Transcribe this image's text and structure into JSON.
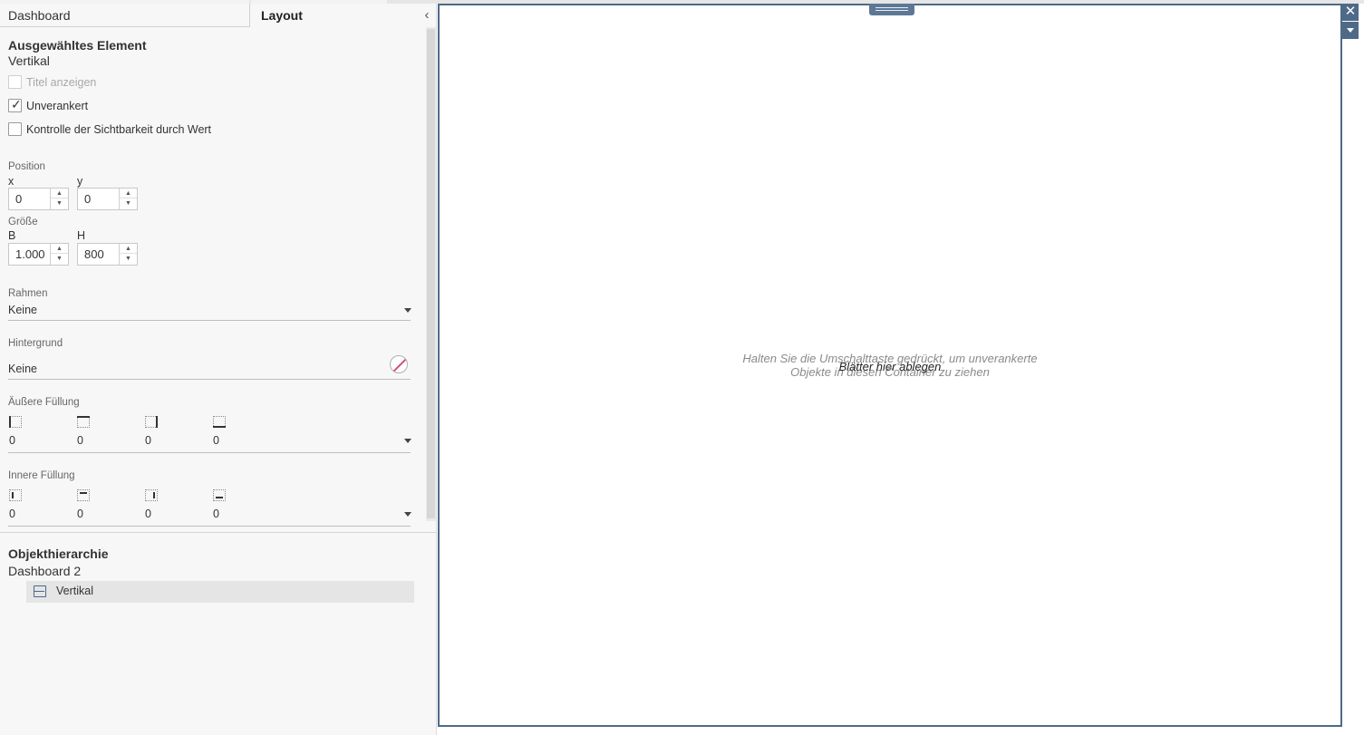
{
  "tabs": {
    "dashboard": "Dashboard",
    "layout": "Layout"
  },
  "collapse_glyph": "‹",
  "selected": {
    "heading": "Ausgewähltes Element",
    "type": "Vertikal"
  },
  "checkboxes": {
    "show_title": {
      "label": "Titel anzeigen",
      "checked": false,
      "disabled": true
    },
    "floating": {
      "label": "Unverankert",
      "checked": true,
      "disabled": false
    },
    "visibility": {
      "label": "Kontrolle der Sichtbarkeit durch Wert",
      "checked": false,
      "disabled": false
    }
  },
  "check_glyph": "✓",
  "position": {
    "label": "Position",
    "x_label": "x",
    "y_label": "y",
    "x": "0",
    "y": "0"
  },
  "size": {
    "label": "Größe",
    "w_label": "B",
    "h_label": "H",
    "w": "1.000",
    "h": "800"
  },
  "spin_up": "▲",
  "spin_down": "▼",
  "border": {
    "label": "Rahmen",
    "value": "Keine"
  },
  "background": {
    "label": "Hintergrund",
    "value": "Keine"
  },
  "outer_padding": {
    "label": "Äußere Füllung",
    "left": "0",
    "top": "0",
    "right": "0",
    "bottom": "0"
  },
  "inner_padding": {
    "label": "Innere Füllung",
    "left": "0",
    "top": "0",
    "right": "0",
    "bottom": "0"
  },
  "hierarchy": {
    "heading": "Objekthierarchie",
    "root": "Dashboard 2",
    "item": "Vertikal"
  },
  "canvas": {
    "hint_line1": "Halten Sie die Umschalttaste gedrückt, um unverankerte",
    "hint_line2": "Objekte in diesen Container zu ziehen",
    "drop_text": "Blätter hier ablegen"
  },
  "close_glyph": "✕",
  "colors": {
    "accent": "#4e6a88",
    "panel_bg": "#f7f7f7"
  },
  "icons": [
    "chevron-left-icon",
    "check-icon",
    "no-color-icon",
    "padding-left-icon",
    "padding-top-icon",
    "padding-right-icon",
    "padding-bottom-icon",
    "vertical-container-icon",
    "close-icon",
    "dropdown-caret-icon"
  ]
}
